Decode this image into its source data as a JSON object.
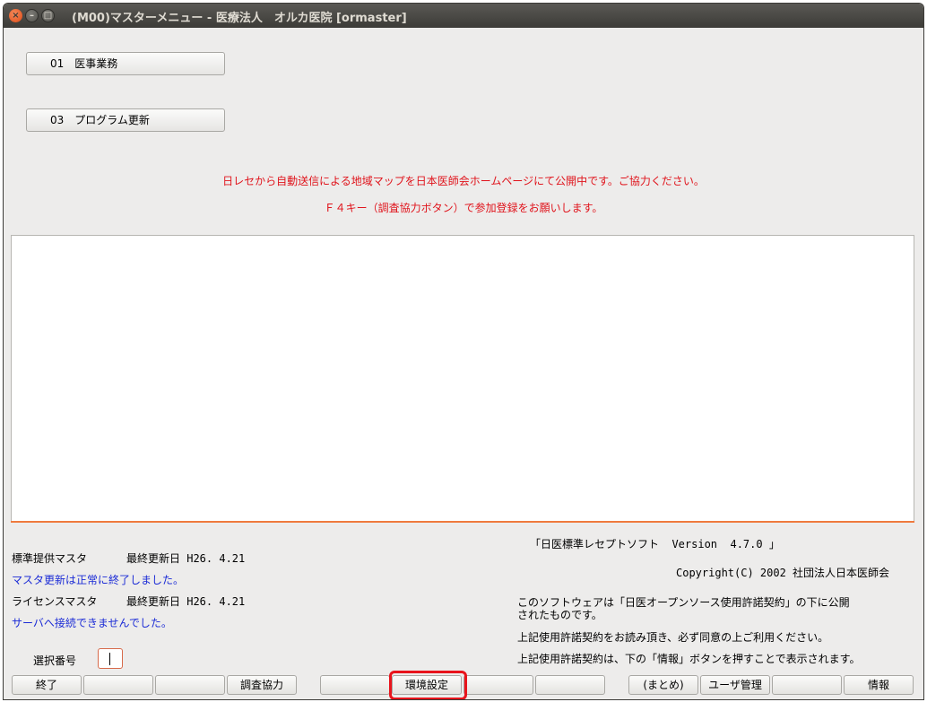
{
  "window": {
    "title": "(M00)マスターメニュー - 医療法人　オルカ医院 [ormaster]",
    "close_glyph": "×",
    "minimize_glyph": "–",
    "maximize_glyph": "□"
  },
  "menu": [
    {
      "label": "01　医事業務"
    },
    {
      "label": "03　プログラム更新"
    }
  ],
  "notices": [
    "日レセから自動送信による地域マップを日本医師会ホームページにて公開中です。ご協力ください。",
    "Ｆ４キー（調査協力ボタン）で参加登録をお願いします。"
  ],
  "status": {
    "master1_label": "標準提供マスタ",
    "master1_date": "最終更新日 H26. 4.21",
    "master1_message": "マスタ更新は正常に終了しました。",
    "master2_label": "ライセンスマスタ",
    "master2_date": "最終更新日 H26. 4.21",
    "master2_message": "サーバへ接続できませんでした。"
  },
  "about": {
    "version": "「日医標準レセプトソフト  Version  4.7.0 」",
    "copyright": "Copyright(C) 2002 社団法人日本医師会",
    "license_line1": "このソフトウェアは「日医オープンソース使用許諾契約」の下に公開",
    "license_line2": "されたものです。",
    "license_line3": "上記使用許諾契約をお読み頂き、必ず同意の上ご利用ください。",
    "license_line4": "上記使用許諾契約は、下の「情報」ボタンを押すことで表示されます。"
  },
  "selection": {
    "label": "選択番号",
    "value": ""
  },
  "function_keys": {
    "f1": "終了",
    "f2": "",
    "f3": "",
    "f4": "調査協力",
    "f5": "",
    "f6": "環境設定",
    "f7": "",
    "f8": "",
    "f9": "(まとめ)",
    "f10": "ユーザ管理",
    "f11": "",
    "f12": "情報"
  },
  "colors": {
    "notice_red": "#e0141c",
    "status_blue": "#1b2bd6",
    "divider_orange": "#ef7a3e",
    "highlight_red": "#e8141c"
  }
}
